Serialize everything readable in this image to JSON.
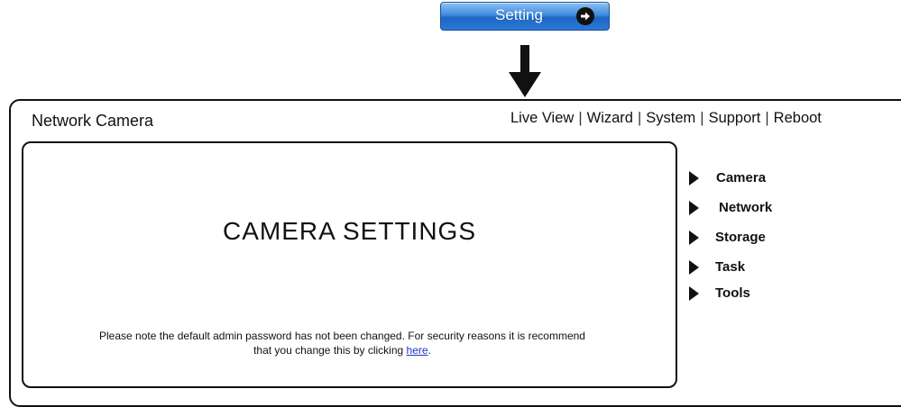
{
  "setting_button": {
    "label": "Setting",
    "icon": "arrow-right-circle-icon"
  },
  "header": {
    "brand": "Network Camera"
  },
  "topnav": {
    "items": [
      "Live View",
      "Wizard",
      "System",
      "Support",
      "Reboot"
    ],
    "separator": "|"
  },
  "panel": {
    "title": "CAMERA SETTINGS",
    "notice_line1": "Please note the default admin password has not been changed. For security reasons it is recommend",
    "notice_line2": "that you change this by clicking",
    "notice_link": "here",
    "notice_end": "."
  },
  "sidemenu": {
    "items": [
      "Camera",
      "Network",
      "Storage",
      "Task",
      "Tools"
    ],
    "icon": "triangle-right-icon"
  },
  "colors": {
    "button_top": "#8fc2f2",
    "button_bottom": "#1e66c4",
    "link": "#2034c8"
  }
}
